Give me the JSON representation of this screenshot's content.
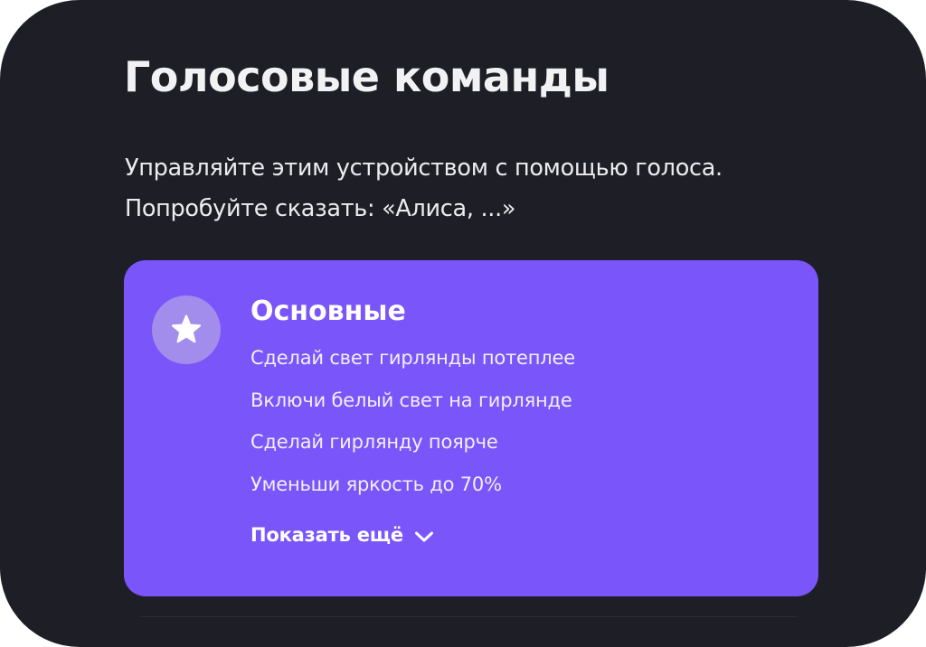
{
  "page": {
    "title": "Голосовые команды",
    "subtitle_lines": [
      "Управляйте этим устройством с помощью голоса.",
      "Попробуйте сказать: «Алиса, ...»"
    ]
  },
  "card": {
    "icon": "star-icon",
    "title": "Основные",
    "commands": [
      "Сделай свет гирлянды потеплее",
      "Включи белый свет на гирлянде",
      "Сделай гирлянду поярче",
      "Уменьши яркость до 70%"
    ],
    "show_more_label": "Показать ещё",
    "show_more_icon": "chevron-down-icon"
  },
  "colors": {
    "background": "#1e1f26",
    "accent": "#7a55fa",
    "icon_badge": "#a28cec",
    "text": "#ffffff"
  }
}
